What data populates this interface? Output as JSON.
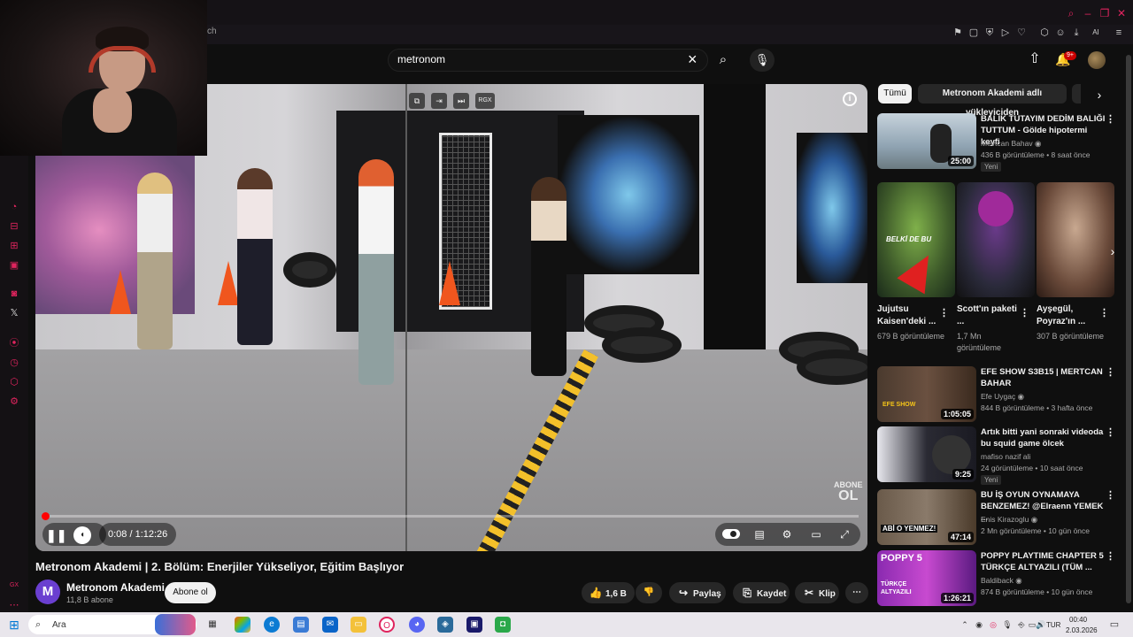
{
  "browser": {
    "tab_fragment": "ch",
    "toolbar_icons": [
      "bookmark-icon",
      "tab-icon",
      "shield-icon",
      "play-icon",
      "heart-icon",
      "extensions-icon",
      "account-icon",
      "download-icon",
      "ai-icon",
      "menu-icon"
    ],
    "ai_label": "AI",
    "window_controls": [
      "search-icon",
      "minimize-icon",
      "restore-icon",
      "close-icon"
    ]
  },
  "header": {
    "search_value": "metronom",
    "notifications_badge": "9+"
  },
  "player": {
    "time": "0:08 / 1:12:26",
    "progress_fraction": 0.0016,
    "overlay_buttons": [
      "⧉",
      "⇥",
      "⏭",
      "RGX"
    ],
    "watermark_top": "ABONE",
    "watermark_bottom": "OL",
    "autoplay_on": true
  },
  "video": {
    "title": "Metronom Akademi | 2. Bölüm: Enerjiler Yükseliyor, Eğitim Başlıyor",
    "channel_name": "Metronom Akademi",
    "channel_initial": "M",
    "channel_subs": "11,8 B abone",
    "subscribe_label": "Abone ol",
    "like_count": "1,6 B",
    "share_label": "Paylaş",
    "save_label": "Kaydet",
    "clip_label": "Klip"
  },
  "chips": {
    "all": "Tümü",
    "channel": "Metronom Akademi adlı yükleyiciden"
  },
  "related_top": {
    "title": "BALIK TUTAYIM DEDİM BALIĞI TUTTUM - Gölde hipotermi keyfi",
    "channel": "Mevtcan Bahav",
    "meta": "436 B görüntüleme • 8 saat önce",
    "badge": "Yeni",
    "duration": "25:00"
  },
  "shorts": [
    {
      "title": "Jujutsu Kaisen'deki ...",
      "views": "679 B görüntüleme",
      "caption": "BELKİ DE BU"
    },
    {
      "title": "Scott'ın paketi ...",
      "views": "1,7 Mn görüntüleme",
      "caption": ""
    },
    {
      "title": "Ayşegül, Poyraz'ın ...",
      "views": "307 B görüntüleme",
      "caption": ""
    }
  ],
  "related": [
    {
      "title": "EFE SHOW S3B15 | MERTCAN BAHAR",
      "channel": "Efe Uygaç",
      "meta": "844 B görüntüleme • 3 hafta önce",
      "badge": "",
      "duration": "1:05:05",
      "thumb_color": "#3a2a1e"
    },
    {
      "title": "Artık bitti yani sonraki videoda bu squid game ölcek",
      "channel": "mafiso nazif ali",
      "meta": "24 görüntüleme • 10 saat önce",
      "badge": "Yeni",
      "duration": "9:25",
      "thumb_color": "#2a2a33"
    },
    {
      "title": "BU İŞ OYUN OYNAMAYA BENZEMEZ! @Elraenn YEMEK ...",
      "channel": "Enis Kirazoglu",
      "meta": "2 Mn görüntüleme • 10 gün önce",
      "badge": "",
      "duration": "47:14",
      "thumb_color": "#5a4a3a"
    },
    {
      "title": "POPPY PLAYTIME CHAPTER 5 TÜRKÇE ALTYAZILI (TÜM ...",
      "channel": "Baldiback",
      "meta": "874 B görüntüleme • 10 gün önce",
      "badge": "",
      "duration": "1:26:21",
      "thumb_color": "#7a2aa0"
    }
  ],
  "thumb_texts": {
    "efe_show": "EFE SHOW",
    "abi_o": "ABİ O YENMEZ!",
    "poppy": "POPPY 5",
    "turkce": "TÜRKÇE ALTYAZILI"
  },
  "taskbar": {
    "search_placeholder": "Ara",
    "language": "TUR",
    "time": "00:40",
    "date": "2.03.2026"
  }
}
